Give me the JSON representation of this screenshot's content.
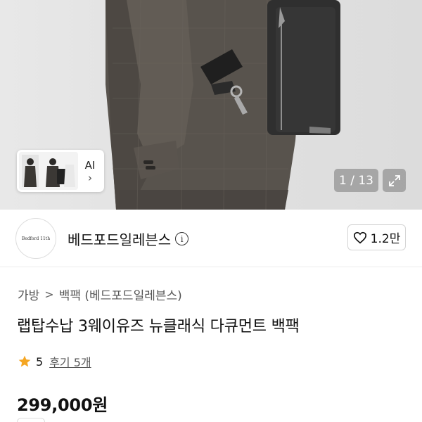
{
  "gallery": {
    "thumbnail_label": "AI",
    "thumbnail_chevron": "›",
    "counter": "1 / 13",
    "icons": {
      "expand": "expand-arrows-icon",
      "chevron": "chevron-right-icon"
    }
  },
  "seller": {
    "logo_text": "Bedford 11th",
    "name": "베드포드일레븐스",
    "info_icon_glyph": "i",
    "like_count": "1.2만",
    "icons": {
      "info": "info-circle-icon",
      "like": "heart-outline-icon"
    }
  },
  "product": {
    "breadcrumb": [
      "가방",
      "백팩 (베드포드일레븐스)"
    ],
    "breadcrumb_separator": ">",
    "title": "랩탑수납 3웨이유즈 뉴클래식 다큐먼트 백팩",
    "rating": {
      "score": "5",
      "star_color": "#f5a623",
      "review_link": "후기 5개"
    },
    "price": "299,000원"
  }
}
